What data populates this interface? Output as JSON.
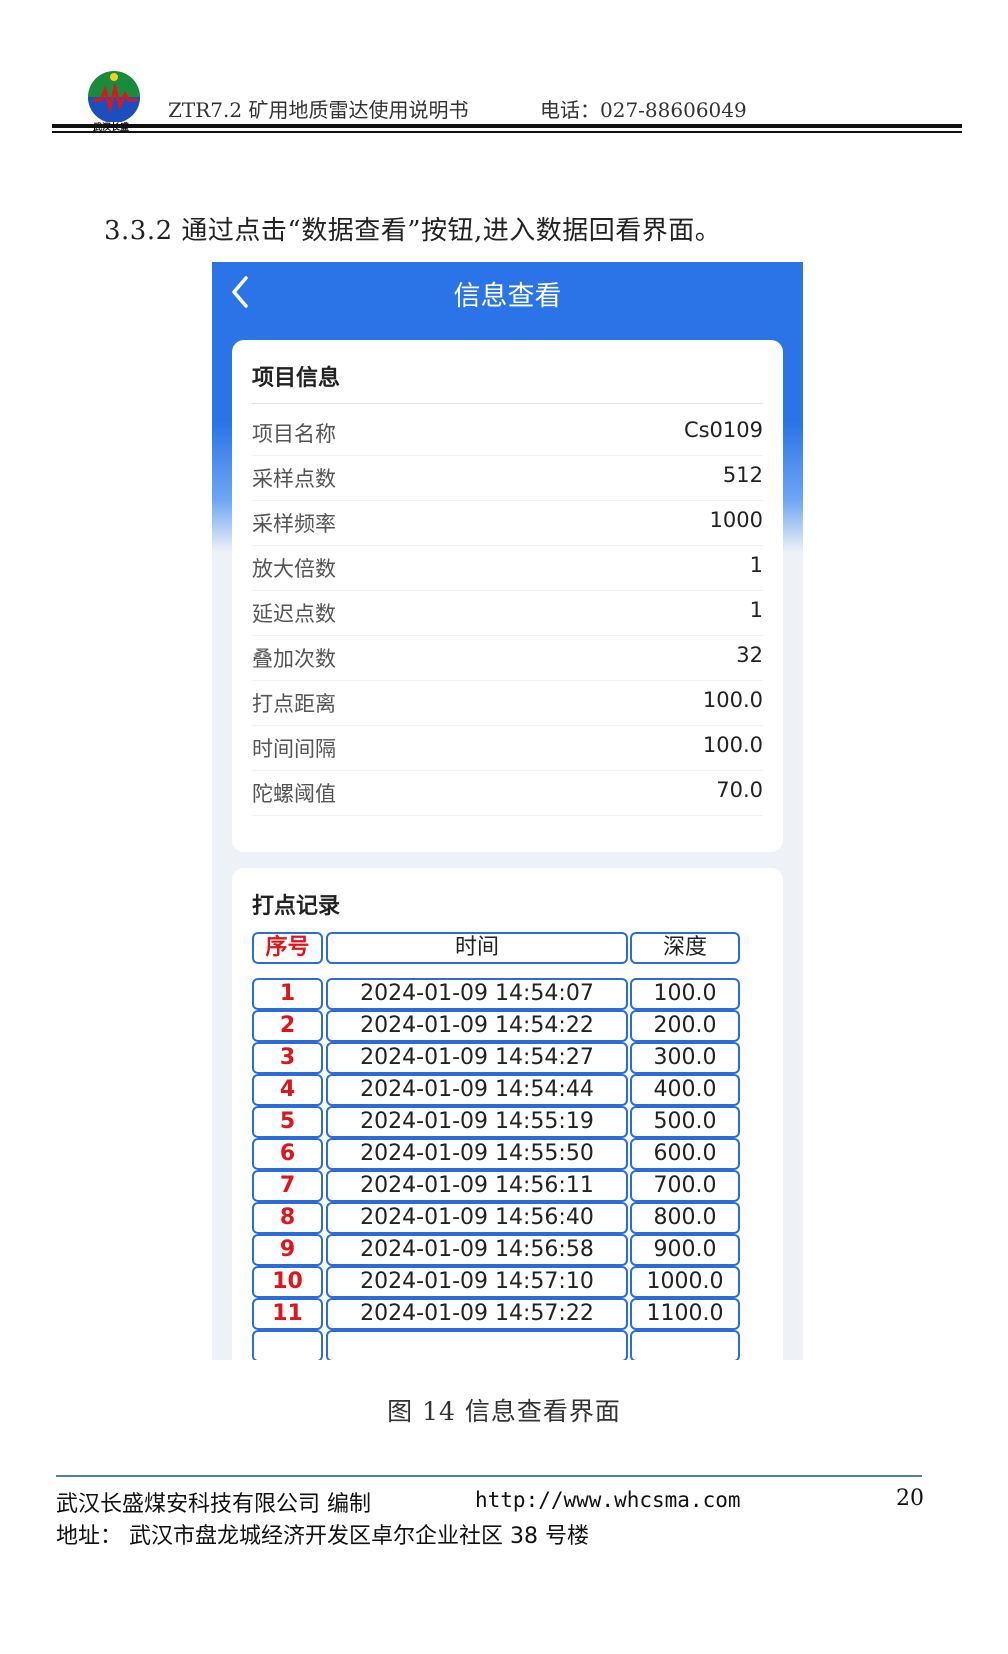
{
  "header": {
    "logo_text": "武汉长盛",
    "title": "ZTR7.2 矿用地质雷达使用说明书",
    "phone": "电话：027-88606049"
  },
  "intro": "3.3.2 通过点击“数据查看”按钮,进入数据回看界面。",
  "screen": {
    "title": "信息查看",
    "back_icon": "chevron-left-icon",
    "info_card": {
      "title": "项目信息",
      "rows": [
        {
          "label": "项目名称",
          "value": "Cs0109"
        },
        {
          "label": "采样点数",
          "value": "512"
        },
        {
          "label": "采样频率",
          "value": "1000"
        },
        {
          "label": "放大倍数",
          "value": "1"
        },
        {
          "label": "延迟点数",
          "value": "1"
        },
        {
          "label": "叠加次数",
          "value": "32"
        },
        {
          "label": "打点距离",
          "value": "100.0"
        },
        {
          "label": "时间间隔",
          "value": "100.0"
        },
        {
          "label": "陀螺阈值",
          "value": "70.0"
        }
      ]
    },
    "record_card": {
      "title": "打点记录",
      "columns": [
        "序号",
        "时间",
        "深度"
      ],
      "rows": [
        {
          "no": "1",
          "time": "2024-01-09 14:54:07",
          "depth": "100.0"
        },
        {
          "no": "2",
          "time": "2024-01-09 14:54:22",
          "depth": "200.0"
        },
        {
          "no": "3",
          "time": "2024-01-09 14:54:27",
          "depth": "300.0"
        },
        {
          "no": "4",
          "time": "2024-01-09 14:54:44",
          "depth": "400.0"
        },
        {
          "no": "5",
          "time": "2024-01-09 14:55:19",
          "depth": "500.0"
        },
        {
          "no": "6",
          "time": "2024-01-09 14:55:50",
          "depth": "600.0"
        },
        {
          "no": "7",
          "time": "2024-01-09 14:56:11",
          "depth": "700.0"
        },
        {
          "no": "8",
          "time": "2024-01-09 14:56:40",
          "depth": "800.0"
        },
        {
          "no": "9",
          "time": "2024-01-09 14:56:58",
          "depth": "900.0"
        },
        {
          "no": "10",
          "time": "2024-01-09 14:57:10",
          "depth": "1000.0"
        },
        {
          "no": "11",
          "time": "2024-01-09 14:57:22",
          "depth": "1100.0"
        }
      ]
    }
  },
  "caption": "图 14 信息查看界面",
  "footer": {
    "company": "武汉长盛煤安科技有限公司 编制",
    "url": "http://www.whcsma.com",
    "page": "20",
    "address": "地址： 武汉市盘龙城经济开发区卓尔企业社区 38 号楼"
  },
  "colors": {
    "app_blue": "#2b74e8",
    "table_border": "#2b6cdc",
    "index_red": "#e0141a",
    "footer_rule": "#4d7cc4"
  }
}
